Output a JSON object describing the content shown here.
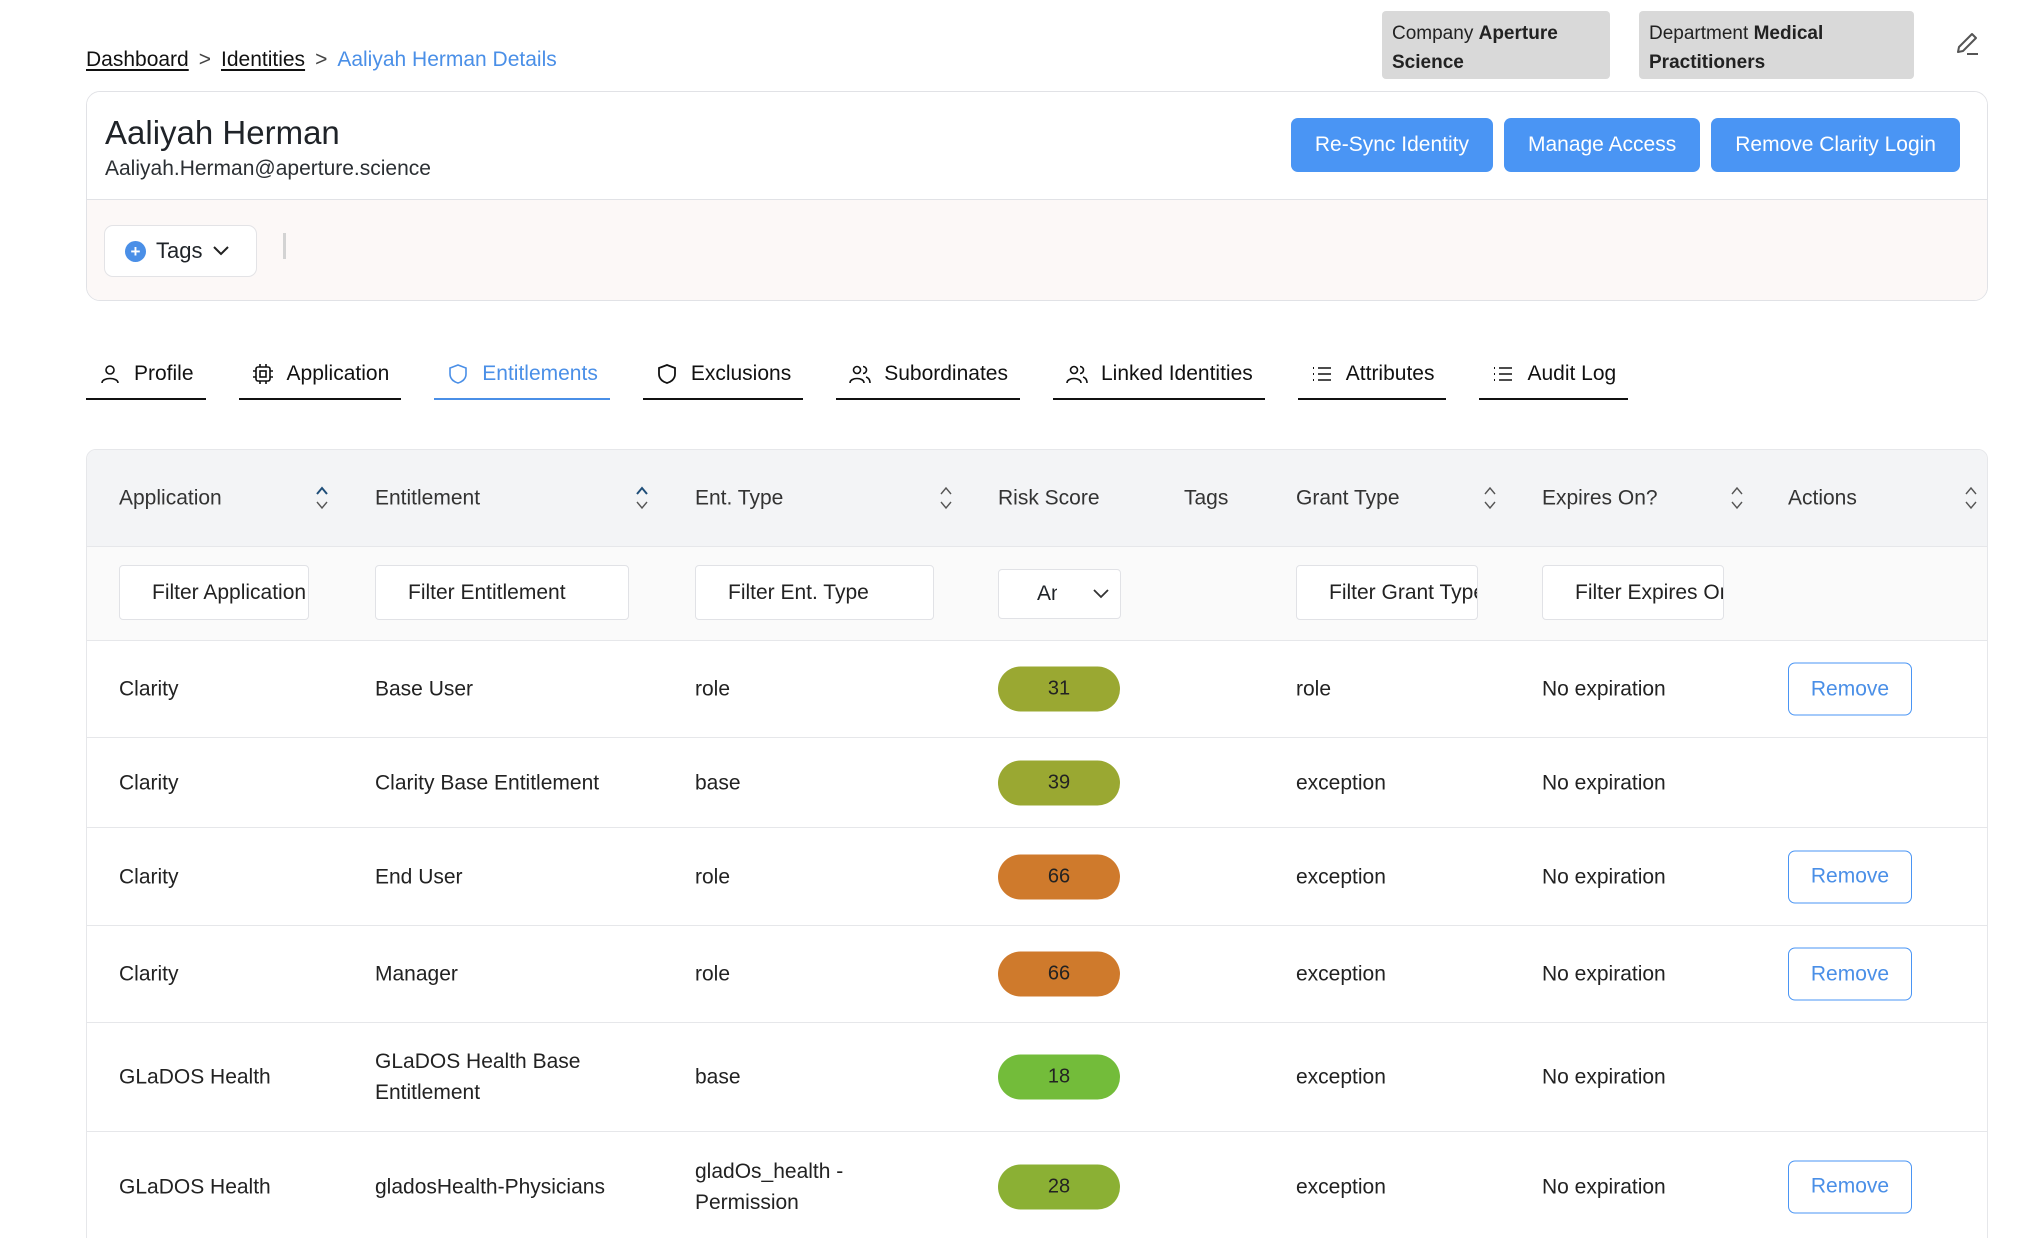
{
  "breadcrumb": {
    "items": [
      "Dashboard",
      "Identities"
    ],
    "separator": ">",
    "current": "Aaliyah Herman Details"
  },
  "pills": {
    "company": {
      "label": "Company",
      "value": "Aperture Science"
    },
    "department": {
      "label": "Department",
      "value": "Medical Practitioners"
    }
  },
  "identity": {
    "name": "Aaliyah Herman",
    "email": "Aaliyah.Herman@aperture.science"
  },
  "actions": {
    "resync": "Re-Sync Identity",
    "manage": "Manage Access",
    "remove_login": "Remove Clarity Login"
  },
  "tags": {
    "label": "Tags"
  },
  "tabs": [
    {
      "label": "Profile",
      "icon": "user-icon"
    },
    {
      "label": "Application",
      "icon": "chip-icon"
    },
    {
      "label": "Entitlements",
      "icon": "shield-icon",
      "active": true
    },
    {
      "label": "Exclusions",
      "icon": "shield-icon"
    },
    {
      "label": "Subordinates",
      "icon": "users-icon"
    },
    {
      "label": "Linked Identities",
      "icon": "users-icon"
    },
    {
      "label": "Attributes",
      "icon": "list-icon"
    },
    {
      "label": "Audit Log",
      "icon": "list-icon"
    }
  ],
  "table": {
    "columns": [
      "Application",
      "Entitlement",
      "Ent. Type",
      "Risk Score",
      "Tags",
      "Grant Type",
      "Expires On?",
      "Actions"
    ],
    "filters": {
      "application": "Filter Application",
      "entitlement": "Filter Entitlement",
      "ent_type": "Filter Ent. Type",
      "risk": "Any",
      "grant_type": "Filter Grant Type",
      "expires": "Filter Expires On?"
    },
    "remove_label": "Remove",
    "rows": [
      {
        "application": "Clarity",
        "entitlement": "Base User",
        "ent_type": "role",
        "risk": "31",
        "risk_color": "#9aa832",
        "grant_type": "role",
        "expires": "No expiration",
        "removable": true
      },
      {
        "application": "Clarity",
        "entitlement": "Clarity Base Entitlement",
        "ent_type": "base",
        "risk": "39",
        "risk_color": "#9aa832",
        "grant_type": "exception",
        "expires": "No expiration",
        "removable": false
      },
      {
        "application": "Clarity",
        "entitlement": "End User",
        "ent_type": "role",
        "risk": "66",
        "risk_color": "#cf7a2c",
        "grant_type": "exception",
        "expires": "No expiration",
        "removable": true
      },
      {
        "application": "Clarity",
        "entitlement": "Manager",
        "ent_type": "role",
        "risk": "66",
        "risk_color": "#cf7a2c",
        "grant_type": "exception",
        "expires": "No expiration",
        "removable": true
      },
      {
        "application": "GLaDOS Health",
        "entitlement": "GLaDOS Health Base Entitlement",
        "ent_type": "base",
        "risk": "18",
        "risk_color": "#73bc3a",
        "grant_type": "exception",
        "expires": "No expiration",
        "removable": false
      },
      {
        "application": "GLaDOS Health",
        "entitlement": "gladosHealth-Physicians",
        "ent_type": "gladOs_health - Permission",
        "risk": "28",
        "risk_color": "#8bb034",
        "grant_type": "exception",
        "expires": "No expiration",
        "removable": true
      }
    ]
  }
}
